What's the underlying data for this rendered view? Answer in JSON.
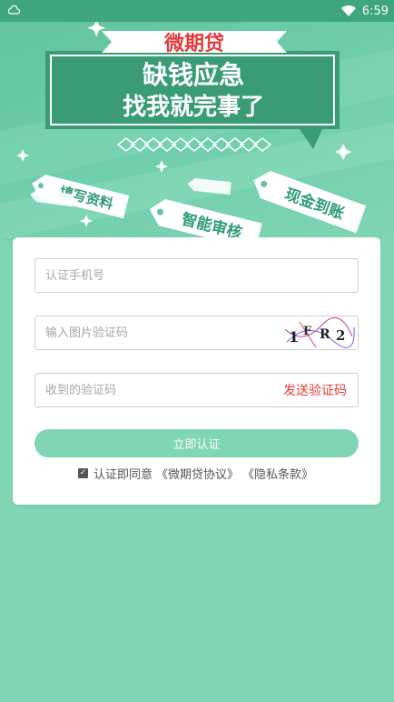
{
  "status_bar": {
    "time": "6:59"
  },
  "hero": {
    "brand": "微期贷",
    "headline_1": "缺钱应急",
    "headline_2": "找我就完事了",
    "tags": [
      "填写资料",
      "智能审核",
      "现金到账"
    ]
  },
  "form": {
    "phone_placeholder": "认证手机号",
    "captcha_placeholder": "输入图片验证码",
    "captcha_code": [
      "1",
      "F",
      "R",
      "2"
    ],
    "sms_placeholder": "收到的验证码",
    "sms_send_label": "发送验证码",
    "submit_label": "立即认证",
    "agree_prefix": "认证即同意",
    "agreement_link": "《微期贷协议》",
    "privacy_link": "《隐私条款》",
    "agree_checked": true
  },
  "colors": {
    "background": "#7fd5b4",
    "status_bar": "#3fa57f",
    "accent_red": "#ea3a3a",
    "tag_text": "#2f9c73"
  }
}
